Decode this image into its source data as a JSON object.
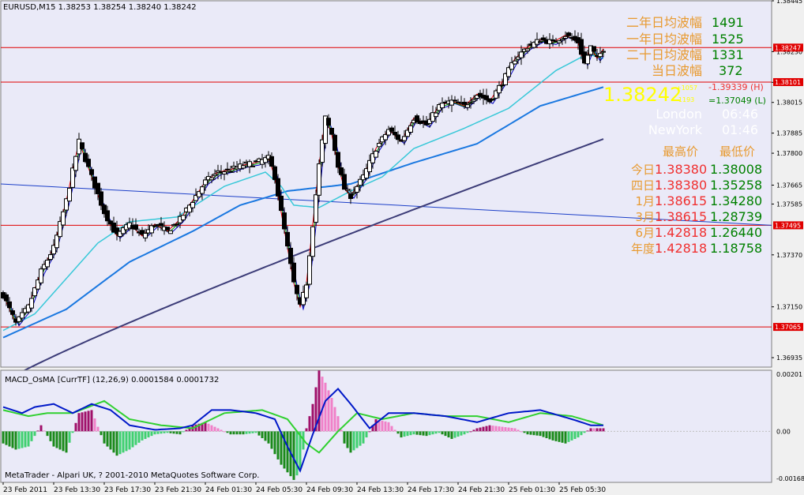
{
  "header": {
    "symbol_line": "EURUSD,M15  1.38253 1.38254 1.38240 1.38242",
    "indicator_line": "MACD_OsMA [CurrTF] (12,26,9) 0.0001584 0.0001732",
    "copyright": "MetaTrader - Alpari UK, ? 2001-2010 MetaQuotes Software Corp."
  },
  "colors": {
    "background": "#eaeaf8",
    "bull_bar": "#000000",
    "bear_bar": "#000000",
    "hline": "#e00000",
    "trendline": "#1c3fc8",
    "ma_slow": "#3c3c78",
    "ma_mid": "#1a78e0",
    "ma_fast": "#38c8d8",
    "ma_short_red": "#e00000",
    "ma_short_green": "#00a000",
    "ma_short_blue": "#0000c0",
    "osma_pos": "#a0106a",
    "osma_pos_light": "#f080c8",
    "osma_neg": "#1a8a1a",
    "osma_neg_light": "#40d070",
    "macd_line": "#0018c8",
    "signal_line": "#30d030",
    "orange": "#e89a30",
    "green_value": "#008000",
    "red_value": "#f03030",
    "yellow": "#ffff00"
  },
  "info_panel": {
    "amplitude_rows": [
      {
        "label": "二年日均波幅",
        "value": "1491"
      },
      {
        "label": "一年日均波幅",
        "value": "1525"
      },
      {
        "label": "二十日均波幅",
        "value": "1331"
      },
      {
        "label": "当日波幅",
        "value": "372"
      }
    ],
    "current_price": "1.38242",
    "small_up_text": "+1057",
    "small_down_text": "-1193",
    "high_text": "-1.39339 (H)",
    "low_text": "=1.37049 (L)",
    "times": [
      {
        "city": "London",
        "time": "06:46"
      },
      {
        "city": "NewYork",
        "time": "01:46"
      }
    ],
    "hl_header_high": "最高价",
    "hl_header_low": "最低价",
    "hl_rows": [
      {
        "label": "今日",
        "high": "1.38380",
        "low": "1.38008"
      },
      {
        "label": "四日",
        "high": "1.38380",
        "low": "1.35258"
      },
      {
        "label": "1月",
        "high": "1.38615",
        "low": "1.34280"
      },
      {
        "label": "3月",
        "high": "1.38615",
        "low": "1.28739"
      },
      {
        "label": "6月",
        "high": "1.42818",
        "low": "1.26440"
      },
      {
        "label": "年度",
        "high": "1.42818",
        "low": "1.18758"
      }
    ]
  },
  "chart_data": [
    {
      "type": "candlestick",
      "title": "EURUSD,M15",
      "ylim": [
        1.36895,
        1.38445
      ],
      "y_ticks": [
        "1.38445",
        "1.38230",
        "1.38015",
        "1.37800",
        "1.37585",
        "1.37370",
        "1.37150",
        "1.36935",
        "1.37665",
        "1.37885",
        "1.38100"
      ],
      "y_tick_labels": [
        "1.38445",
        "1.38230",
        "1.38015",
        "1.37800",
        "1.37585",
        "1.37370",
        "1.37150",
        "1.36935",
        "1.37665",
        "1.37885",
        "1.38100"
      ],
      "x_tick_labels": [
        "23 Feb 2011",
        "23 Feb 13:30",
        "23 Feb 17:30",
        "23 Feb 21:30",
        "24 Feb 01:30",
        "24 Feb 05:30",
        "24 Feb 09:30",
        "24 Feb 13:30",
        "24 Feb 17:30",
        "24 Feb 21:30",
        "25 Feb 01:30",
        "25 Feb 05:30"
      ],
      "price_tags": [
        "1.38247",
        "1.38101",
        "1.37495",
        "1.37065"
      ],
      "hlines": [
        1.38247,
        1.38101,
        1.37495,
        1.37065
      ],
      "trendline": {
        "start": 1.3767,
        "end": 1.37495
      },
      "ma_slow": {
        "start": 1.3683,
        "end": 1.3786
      },
      "ma_mid_keypoints": [
        [
          0,
          1.3702
        ],
        [
          20,
          1.3714
        ],
        [
          40,
          1.3734
        ],
        [
          60,
          1.3747
        ],
        [
          75,
          1.3758
        ],
        [
          90,
          1.3764
        ],
        [
          110,
          1.3767
        ],
        [
          130,
          1.3776
        ],
        [
          150,
          1.3784
        ],
        [
          170,
          1.38
        ],
        [
          190,
          1.3808
        ]
      ],
      "ma_fast_keypoints": [
        [
          0,
          1.3705
        ],
        [
          10,
          1.3712
        ],
        [
          20,
          1.3727
        ],
        [
          30,
          1.3742
        ],
        [
          40,
          1.3751
        ],
        [
          55,
          1.3753
        ],
        [
          70,
          1.3766
        ],
        [
          83,
          1.3772
        ],
        [
          88,
          1.3766
        ],
        [
          92,
          1.3758
        ],
        [
          100,
          1.3757
        ],
        [
          110,
          1.3764
        ],
        [
          120,
          1.377
        ],
        [
          130,
          1.3782
        ],
        [
          145,
          1.379
        ],
        [
          160,
          1.3799
        ],
        [
          175,
          1.3815
        ],
        [
          185,
          1.3822
        ],
        [
          190,
          1.382
        ]
      ],
      "close_keypoints": [
        [
          0,
          1.372
        ],
        [
          4,
          1.3708
        ],
        [
          8,
          1.3715
        ],
        [
          12,
          1.373
        ],
        [
          16,
          1.374
        ],
        [
          20,
          1.376
        ],
        [
          24,
          1.3785
        ],
        [
          28,
          1.377
        ],
        [
          32,
          1.3755
        ],
        [
          36,
          1.3745
        ],
        [
          40,
          1.375
        ],
        [
          44,
          1.3745
        ],
        [
          48,
          1.375
        ],
        [
          52,
          1.3747
        ],
        [
          56,
          1.3752
        ],
        [
          60,
          1.376
        ],
        [
          64,
          1.3768
        ],
        [
          68,
          1.3772
        ],
        [
          72,
          1.3773
        ],
        [
          76,
          1.3775
        ],
        [
          80,
          1.3776
        ],
        [
          84,
          1.3778
        ],
        [
          86,
          1.377
        ],
        [
          88,
          1.3755
        ],
        [
          90,
          1.374
        ],
        [
          92,
          1.3725
        ],
        [
          94,
          1.3715
        ],
        [
          96,
          1.3725
        ],
        [
          98,
          1.375
        ],
        [
          100,
          1.3775
        ],
        [
          102,
          1.3795
        ],
        [
          104,
          1.3788
        ],
        [
          106,
          1.3775
        ],
        [
          108,
          1.3765
        ],
        [
          110,
          1.3762
        ],
        [
          114,
          1.377
        ],
        [
          118,
          1.3782
        ],
        [
          122,
          1.379
        ],
        [
          126,
          1.3785
        ],
        [
          130,
          1.3795
        ],
        [
          134,
          1.3792
        ],
        [
          138,
          1.38
        ],
        [
          142,
          1.3802
        ],
        [
          146,
          1.38
        ],
        [
          150,
          1.3805
        ],
        [
          154,
          1.3802
        ],
        [
          158,
          1.381
        ],
        [
          162,
          1.382
        ],
        [
          166,
          1.3825
        ],
        [
          170,
          1.3828
        ],
        [
          174,
          1.3827
        ],
        [
          178,
          1.383
        ],
        [
          182,
          1.3827
        ],
        [
          184,
          1.3818
        ],
        [
          186,
          1.3825
        ],
        [
          188,
          1.382
        ],
        [
          190,
          1.38242
        ]
      ]
    },
    {
      "type": "bar",
      "title": "MACD_OsMA [CurrTF] (12,26,9)",
      "ylim": [
        -0.00168,
        0.00201
      ],
      "y_tick_labels": [
        "0.00201",
        "0.00",
        "-0.00168"
      ],
      "osma_keypoints": [
        [
          0,
          -0.0004
        ],
        [
          4,
          -0.0006
        ],
        [
          8,
          -0.0005
        ],
        [
          12,
          0.0002
        ],
        [
          16,
          -0.0005
        ],
        [
          20,
          -0.0007
        ],
        [
          24,
          0.0006
        ],
        [
          28,
          0.0007
        ],
        [
          32,
          -0.0004
        ],
        [
          36,
          -0.0008
        ],
        [
          40,
          -0.0006
        ],
        [
          44,
          -0.0003
        ],
        [
          48,
          -0.0001
        ],
        [
          52,
          -5e-05
        ],
        [
          56,
          -0.0001
        ],
        [
          60,
          0.0002
        ],
        [
          64,
          0.0003
        ],
        [
          68,
          0.0001
        ],
        [
          72,
          -0.0001
        ],
        [
          76,
          -0.0001
        ],
        [
          80,
          -5e-05
        ],
        [
          84,
          -0.0004
        ],
        [
          88,
          -0.0011
        ],
        [
          92,
          -0.0016
        ],
        [
          94,
          -0.0013
        ],
        [
          96,
          0.0001
        ],
        [
          98,
          0.0009
        ],
        [
          100,
          0.002
        ],
        [
          102,
          0.0016
        ],
        [
          104,
          0.0011
        ],
        [
          106,
          0.0005
        ],
        [
          108,
          -0.0004
        ],
        [
          110,
          -0.0007
        ],
        [
          114,
          -0.0004
        ],
        [
          118,
          0.0004
        ],
        [
          122,
          0.0003
        ],
        [
          126,
          -0.0002
        ],
        [
          130,
          -0.0001
        ],
        [
          134,
          -0.00015
        ],
        [
          138,
          -5e-05
        ],
        [
          142,
          -0.00025
        ],
        [
          146,
          -0.0001
        ],
        [
          150,
          0.0001
        ],
        [
          154,
          0.0002
        ],
        [
          158,
          0.00015
        ],
        [
          162,
          0.0001
        ],
        [
          166,
          -0.0001
        ],
        [
          170,
          -0.00015
        ],
        [
          174,
          -0.0003
        ],
        [
          178,
          -0.0004
        ],
        [
          182,
          -0.0002
        ],
        [
          186,
          0.0001
        ],
        [
          190,
          0.0001
        ]
      ],
      "macd_keypoints": [
        [
          0,
          0.0008
        ],
        [
          6,
          0.0006
        ],
        [
          10,
          0.0008
        ],
        [
          16,
          0.0009
        ],
        [
          22,
          0.0006
        ],
        [
          28,
          0.0009
        ],
        [
          34,
          0.0007
        ],
        [
          40,
          0.0002
        ],
        [
          48,
          5e-05
        ],
        [
          56,
          0.0001
        ],
        [
          60,
          0.0002
        ],
        [
          66,
          0.0007
        ],
        [
          72,
          0.0007
        ],
        [
          80,
          0.0006
        ],
        [
          86,
          0.0004
        ],
        [
          90,
          -0.0005
        ],
        [
          94,
          -0.0013
        ],
        [
          98,
          -0.0001
        ],
        [
          102,
          0.001
        ],
        [
          106,
          0.0014
        ],
        [
          110,
          0.0009
        ],
        [
          116,
          0.0001
        ],
        [
          122,
          0.0006
        ],
        [
          130,
          0.0006
        ],
        [
          140,
          0.0005
        ],
        [
          150,
          0.0003
        ],
        [
          160,
          0.0006
        ],
        [
          170,
          0.0007
        ],
        [
          180,
          0.0004
        ],
        [
          186,
          0.0002
        ],
        [
          190,
          0.0002
        ]
      ],
      "signal_keypoints": [
        [
          0,
          0.0007
        ],
        [
          8,
          0.0005
        ],
        [
          14,
          0.0006
        ],
        [
          22,
          0.0006
        ],
        [
          32,
          0.001
        ],
        [
          40,
          0.0004
        ],
        [
          50,
          0.0002
        ],
        [
          60,
          0.0001
        ],
        [
          70,
          0.0006
        ],
        [
          82,
          0.0007
        ],
        [
          90,
          0.0004
        ],
        [
          96,
          -0.0004
        ],
        [
          100,
          -0.0007
        ],
        [
          106,
          0.0
        ],
        [
          112,
          0.0006
        ],
        [
          120,
          0.0004
        ],
        [
          130,
          0.0006
        ],
        [
          140,
          0.0005
        ],
        [
          150,
          0.0005
        ],
        [
          160,
          0.0003
        ],
        [
          170,
          0.0006
        ],
        [
          180,
          0.0005
        ],
        [
          190,
          0.0002
        ]
      ]
    }
  ]
}
